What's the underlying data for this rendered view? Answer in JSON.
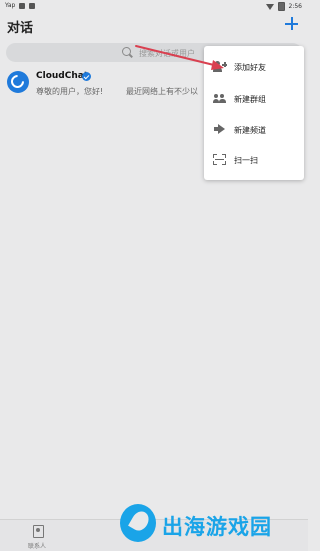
{
  "statusbar": {
    "left_label": "Yap",
    "time": "2:56"
  },
  "header": {
    "title": "对话"
  },
  "search": {
    "placeholder": "搜索对话或用户"
  },
  "chats": [
    {
      "name": "CloudChat",
      "verified": true,
      "preview": "尊敬的用户，您好!",
      "meta": "最近网络上有不少以"
    }
  ],
  "menu": {
    "items": [
      {
        "label": "添加好友",
        "icon": "add-person-icon"
      },
      {
        "label": "新建群组",
        "icon": "group-icon"
      },
      {
        "label": "新建频道",
        "icon": "megaphone-icon"
      },
      {
        "label": "扫一扫",
        "icon": "scan-icon"
      }
    ]
  },
  "bottom_nav": {
    "contacts_label": "联系人"
  },
  "watermark": {
    "text": "出海游戏园"
  },
  "colors": {
    "accent": "#1f7adb",
    "arrow": "#d94050",
    "watermark": "#1aa4e8",
    "background": "#e9e9ea"
  }
}
